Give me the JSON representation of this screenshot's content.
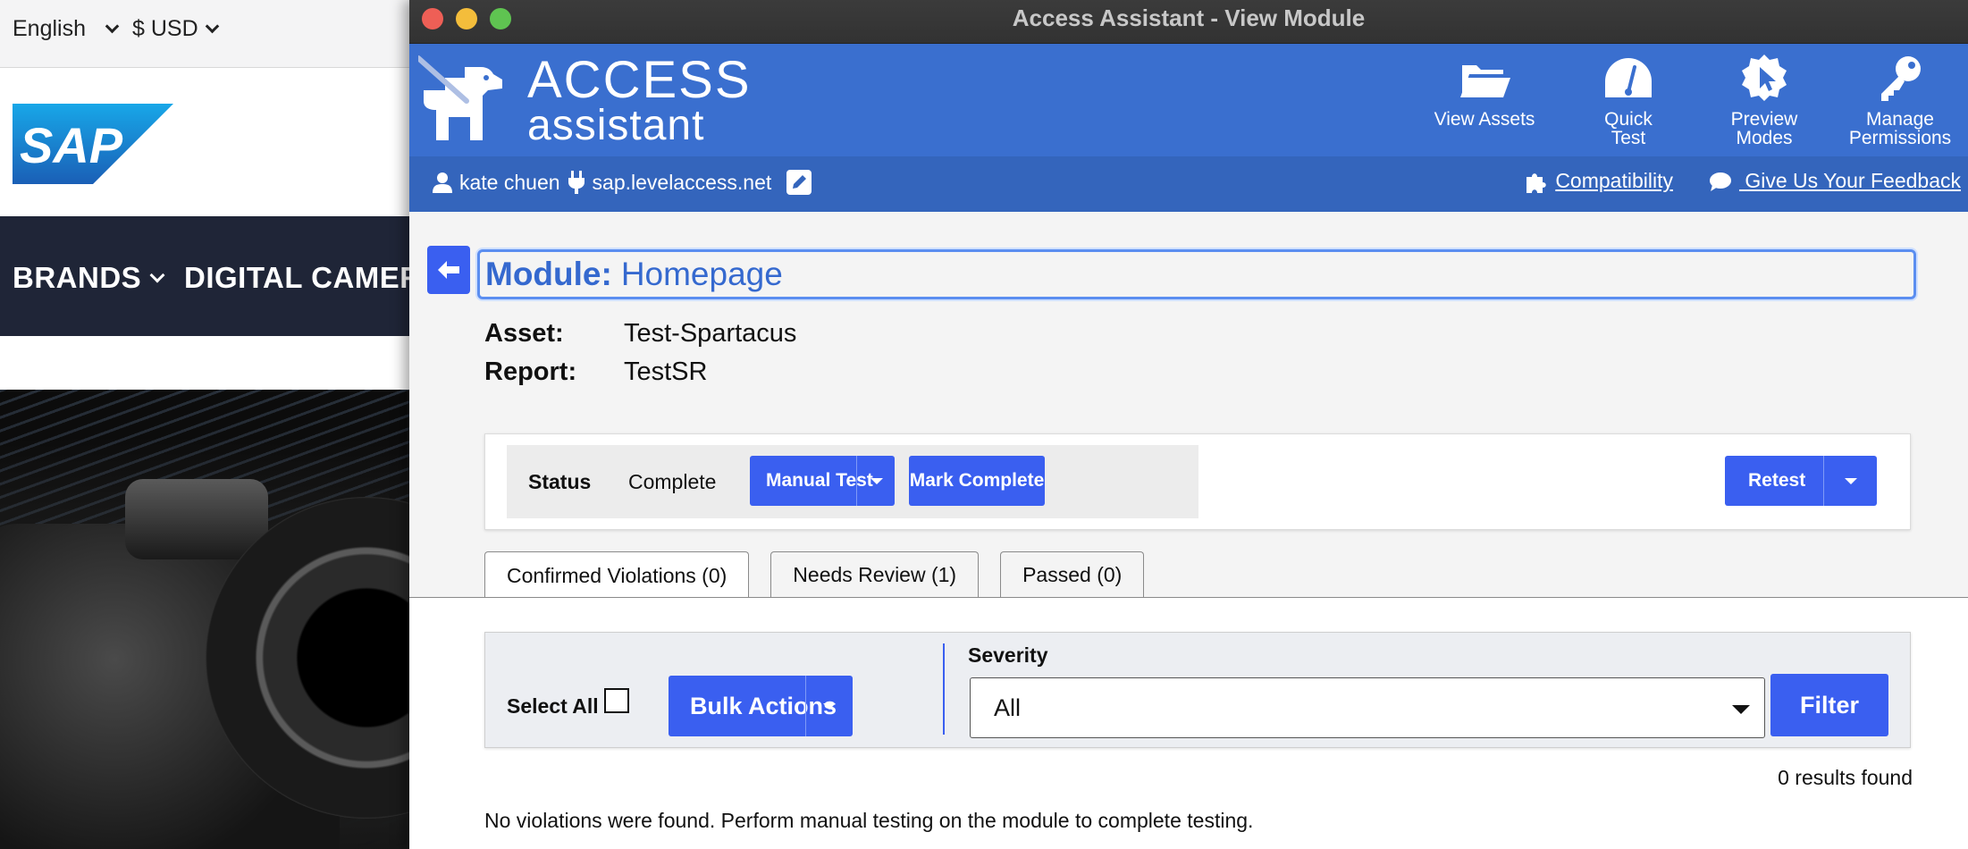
{
  "background_site": {
    "language": "English",
    "currency": "$ USD",
    "logo_text": "SAP",
    "nav": [
      "BRANDS",
      "DIGITAL CAMERA"
    ]
  },
  "window": {
    "title": "Access Assistant - View Module"
  },
  "app_header": {
    "brand_top": "ACCESS",
    "brand_bottom": "assistant",
    "actions": [
      {
        "label": "View Assets",
        "icon": "folder-icon"
      },
      {
        "label": "Quick Test",
        "icon": "gauge-icon"
      },
      {
        "label": "Preview Modes",
        "icon": "cursor-badge-icon"
      },
      {
        "label": "Manage Permissions",
        "icon": "key-icon"
      }
    ]
  },
  "sub_header": {
    "user": "kate chuen",
    "server": "sap.levelaccess.net",
    "compatibility": "Compatibility",
    "feedback": " Give Us Your Feedback"
  },
  "module": {
    "label": "Module:",
    "name": "Homepage",
    "asset_label": "Asset:",
    "asset_value": "Test-Spartacus",
    "report_label": "Report:",
    "report_value": "TestSR"
  },
  "status_bar": {
    "status_label": "Status",
    "status_value": "Complete",
    "manual_test": "Manual Test",
    "mark_complete": "Mark Complete",
    "retest": "Retest"
  },
  "tabs": [
    {
      "label": "Confirmed Violations (0)",
      "active": true
    },
    {
      "label": "Needs Review (1)",
      "active": false
    },
    {
      "label": "Passed (0)",
      "active": false
    }
  ],
  "filters": {
    "select_all": "Select All",
    "bulk_actions": "Bulk Actions",
    "severity_label": "Severity",
    "severity_value": "All",
    "filter_button": "Filter"
  },
  "results": {
    "count_text": "0 results found",
    "message": "No violations were found. Perform manual testing on the module to complete testing."
  },
  "colors": {
    "header_blue": "#3a6fcf",
    "subheader_blue": "#3465bc",
    "button_blue": "#3a5ff0",
    "title_text_blue": "#3569cf"
  }
}
